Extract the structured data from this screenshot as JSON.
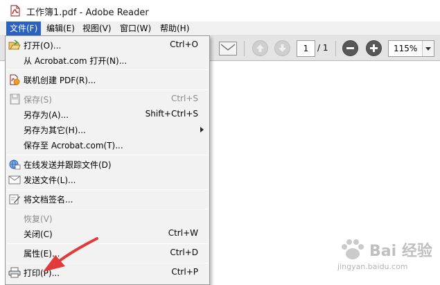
{
  "window": {
    "title": "工作簿1.pdf - Adobe Reader"
  },
  "menubar": {
    "items": [
      {
        "label": "文件(F)",
        "active": true
      },
      {
        "label": "编辑(E)"
      },
      {
        "label": "视图(V)"
      },
      {
        "label": "窗口(W)"
      },
      {
        "label": "帮助(H)"
      }
    ]
  },
  "toolbar": {
    "page_current": "1",
    "page_total": "/ 1",
    "zoom": "115%"
  },
  "file_menu": {
    "items": [
      {
        "label": "打开(O)...",
        "shortcut": "Ctrl+O",
        "icon": "open-folder-icon"
      },
      {
        "label": "从 Acrobat.com 打开(N)...",
        "shortcut": ""
      },
      {
        "label": "联机创建 PDF(R)...",
        "shortcut": "",
        "icon": "create-pdf-icon"
      },
      {
        "label": "保存(S)",
        "shortcut": "Ctrl+S",
        "icon": "save-disk-icon",
        "disabled": true
      },
      {
        "label": "另存为(A)...",
        "shortcut": "Shift+Ctrl+S"
      },
      {
        "label": "另存为其它(H)...",
        "shortcut": "",
        "submenu": true
      },
      {
        "label": "保存至 Acrobat.com(T)...",
        "shortcut": ""
      },
      {
        "label": "在线发送并跟踪文件(D)",
        "shortcut": "",
        "icon": "send-track-icon"
      },
      {
        "label": "发送文件(L)...",
        "shortcut": "",
        "icon": "envelope-icon"
      },
      {
        "label": "将文档签名...",
        "shortcut": "",
        "icon": "sign-document-icon"
      },
      {
        "label": "恢复(V)",
        "shortcut": "",
        "disabled": true
      },
      {
        "label": "关闭(C)",
        "shortcut": "Ctrl+W"
      },
      {
        "label": "属性(E)...",
        "shortcut": "Ctrl+D"
      },
      {
        "label": "打印(P)...",
        "shortcut": "Ctrl+P",
        "icon": "printer-icon"
      }
    ]
  },
  "watermark": {
    "brand": "Bai 经验",
    "url": "jingyan.baidu.com"
  },
  "colors": {
    "menu_active": "#2a62c4",
    "annotation": "#e03a3a"
  }
}
